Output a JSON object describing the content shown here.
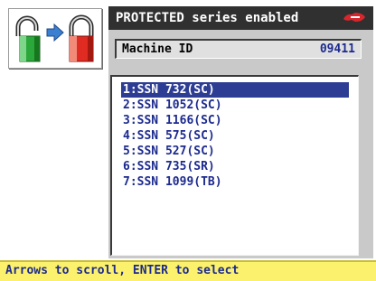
{
  "header": {
    "title": "PROTECTED series enabled",
    "brand_logo_icon": "silca-logo-icon"
  },
  "lock_icon": {
    "left": "unlocked-padlock-icon",
    "arrow": "right-arrow-icon",
    "right": "locked-padlock-icon"
  },
  "machine": {
    "label": "Machine ID",
    "value": "09411"
  },
  "series_list": {
    "selected_index": 0,
    "items": [
      {
        "label": "1:SSN 732(SC)"
      },
      {
        "label": "2:SSN 1052(SC)"
      },
      {
        "label": "3:SSN 1166(SC)"
      },
      {
        "label": "4:SSN 575(SC)"
      },
      {
        "label": "5:SSN 527(SC)"
      },
      {
        "label": "6:SSN 735(SR)"
      },
      {
        "label": "7:SSN 1099(TB)"
      }
    ]
  },
  "status": {
    "text": "Arrows to scroll, ENTER to select"
  },
  "colors": {
    "title_bg": "#303030",
    "panel_bg": "#c9c9c9",
    "list_text": "#1c2a8e",
    "selection_bg": "#2d3d93",
    "status_bg": "#fbf16c",
    "logo_red": "#d8262c",
    "lock_green": "#2aa83a",
    "lock_red": "#e02b22"
  }
}
